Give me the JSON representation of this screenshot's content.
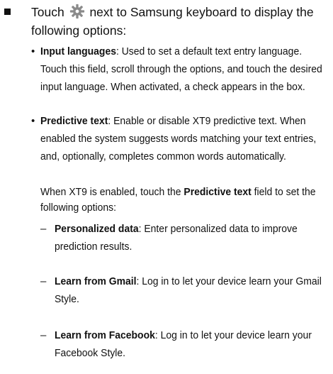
{
  "intro": {
    "prefix": "Touch",
    "icon": "gear-icon",
    "suffix_line1": "next to Samsung keyboard to display the",
    "suffix_line2": "following options:"
  },
  "options": [
    {
      "term": "Input languages",
      "desc": ": Used to set a default text entry language. Touch this field, scroll through the options, and touch the desired input language. When activated, a check appears in the box."
    },
    {
      "term": "Predictive text",
      "desc": ": Enable or disable XT9 predictive text. When enabled the system suggests words matching your text entries, and, optionally, completes common words automatically."
    }
  ],
  "note": {
    "prefix": "When XT9 is enabled, touch the ",
    "term": "Predictive text",
    "suffix": " field to set the following options:"
  },
  "sub_options": [
    {
      "term": "Personalized data",
      "desc": ": Enter personalized data to improve prediction results."
    },
    {
      "term": "Learn from Gmail",
      "desc": ": Log in to let your device learn your Gmail Style."
    },
    {
      "term": "Learn from Facebook",
      "desc": ": Log in to let your device learn your Facebook Style."
    }
  ]
}
